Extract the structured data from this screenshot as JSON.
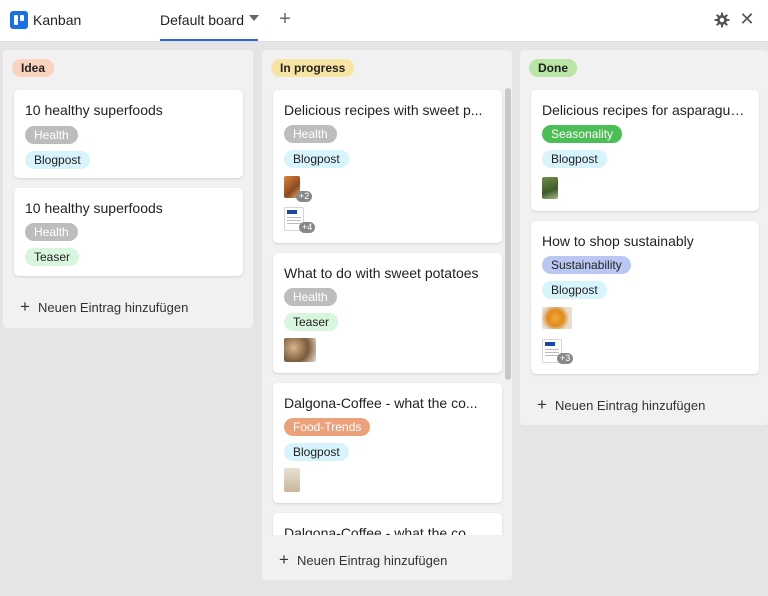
{
  "app": {
    "title": "Kanban"
  },
  "tabs": {
    "active_label": "Default board"
  },
  "columns": {
    "idea": {
      "title": "Idea",
      "color": "#f9d3be",
      "add_label": "Neuen Eintrag hinzufügen",
      "cards": [
        {
          "title": "10 healthy superfoods",
          "tags": [
            "Health",
            "Blogpost"
          ]
        },
        {
          "title": "10 healthy superfoods",
          "tags": [
            "Health",
            "Teaser"
          ]
        }
      ]
    },
    "progress": {
      "title": "In progress",
      "color": "#f7e4a3",
      "add_label": "Neuen Eintrag hinzufügen",
      "cards": [
        {
          "title": "Delicious recipes with sweet p...",
          "tags": [
            "Health",
            "Blogpost"
          ],
          "image_badge": "+2",
          "doc_badge": "+4"
        },
        {
          "title": "What to do with sweet potatoes",
          "tags": [
            "Health",
            "Teaser"
          ]
        },
        {
          "title": "Dalgona-Coffee - what the co...",
          "tags": [
            "Food-Trends",
            "Blogpost"
          ]
        },
        {
          "title": "Dalgona-Coffee - what the co..."
        }
      ]
    },
    "done": {
      "title": "Done",
      "color": "#b9e6a5",
      "add_label": "Neuen Eintrag hinzufügen",
      "cards": [
        {
          "title": "Delicious recipes for asparagus ...",
          "tags": [
            "Seasonality",
            "Blogpost"
          ]
        },
        {
          "title": "How to shop sustainably",
          "tags": [
            "Sustainability",
            "Blogpost"
          ],
          "doc_badge": "+3"
        }
      ]
    }
  },
  "tag_colors": {
    "Health": "#bdbdbd",
    "Blogpost": "#d7f3fb",
    "Teaser": "#d8f5de",
    "Food-Trends": "#eba27a",
    "Seasonality": "#4bbf55",
    "Sustainability": "#b9c8f3"
  },
  "icons": [
    "kanban-logo-icon",
    "chevron-down-icon",
    "plus-icon",
    "gear-icon",
    "close-icon"
  ]
}
